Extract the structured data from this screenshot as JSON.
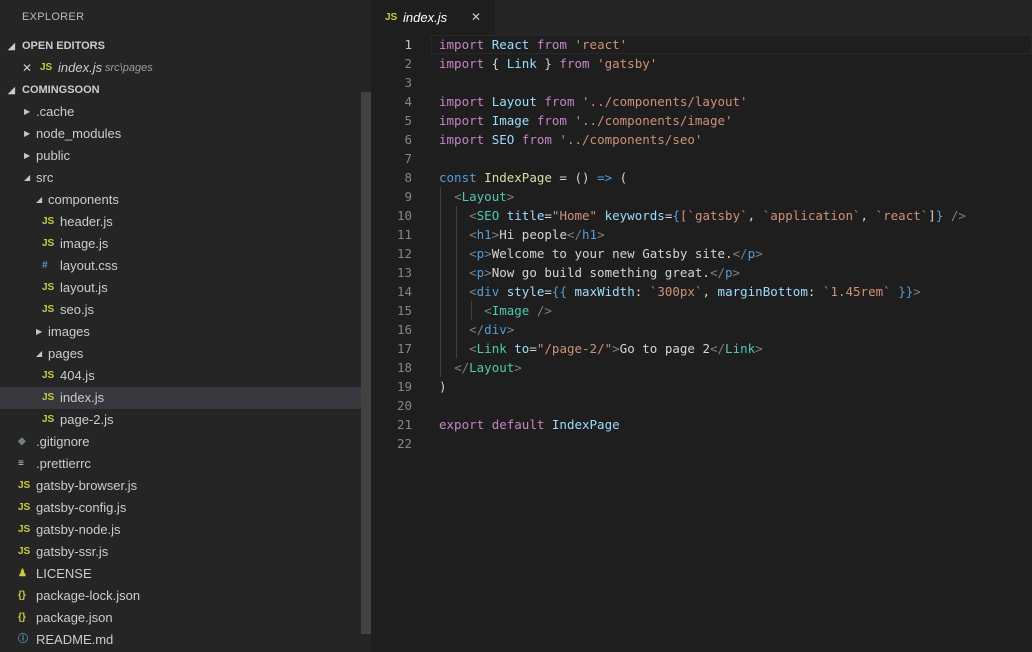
{
  "explorer": {
    "title": "EXPLORER",
    "open_editors_label": "OPEN EDITORS",
    "open_editor": {
      "icon": "JS",
      "name": "index.js",
      "path": "src\\pages"
    },
    "project_label": "COMINGSOON",
    "tree": [
      {
        "name": ".cache",
        "type": "folder",
        "depth": 0,
        "expanded": false,
        "icon": ""
      },
      {
        "name": "node_modules",
        "type": "folder",
        "depth": 0,
        "expanded": false,
        "icon": ""
      },
      {
        "name": "public",
        "type": "folder",
        "depth": 0,
        "expanded": false,
        "icon": ""
      },
      {
        "name": "src",
        "type": "folder",
        "depth": 0,
        "expanded": true,
        "icon": ""
      },
      {
        "name": "components",
        "type": "folder",
        "depth": 1,
        "expanded": true,
        "icon": ""
      },
      {
        "name": "header.js",
        "type": "file",
        "depth": 2,
        "icon": "JS",
        "icon_color": "#cbcb41"
      },
      {
        "name": "image.js",
        "type": "file",
        "depth": 2,
        "icon": "JS",
        "icon_color": "#cbcb41"
      },
      {
        "name": "layout.css",
        "type": "file",
        "depth": 2,
        "icon": "#",
        "icon_color": "#519aba"
      },
      {
        "name": "layout.js",
        "type": "file",
        "depth": 2,
        "icon": "JS",
        "icon_color": "#cbcb41"
      },
      {
        "name": "seo.js",
        "type": "file",
        "depth": 2,
        "icon": "JS",
        "icon_color": "#cbcb41"
      },
      {
        "name": "images",
        "type": "folder",
        "depth": 1,
        "expanded": false,
        "icon": ""
      },
      {
        "name": "pages",
        "type": "folder",
        "depth": 1,
        "expanded": true,
        "icon": ""
      },
      {
        "name": "404.js",
        "type": "file",
        "depth": 2,
        "icon": "JS",
        "icon_color": "#cbcb41"
      },
      {
        "name": "index.js",
        "type": "file",
        "depth": 2,
        "icon": "JS",
        "icon_color": "#cbcb41",
        "selected": true
      },
      {
        "name": "page-2.js",
        "type": "file",
        "depth": 2,
        "icon": "JS",
        "icon_color": "#cbcb41"
      },
      {
        "name": ".gitignore",
        "type": "file",
        "depth": 0,
        "icon": "◆",
        "icon_color": "#6d8086"
      },
      {
        "name": ".prettierrc",
        "type": "file",
        "depth": 0,
        "icon": "≡",
        "icon_color": "#cccccc"
      },
      {
        "name": "gatsby-browser.js",
        "type": "file",
        "depth": 0,
        "icon": "JS",
        "icon_color": "#cbcb41"
      },
      {
        "name": "gatsby-config.js",
        "type": "file",
        "depth": 0,
        "icon": "JS",
        "icon_color": "#cbcb41"
      },
      {
        "name": "gatsby-node.js",
        "type": "file",
        "depth": 0,
        "icon": "JS",
        "icon_color": "#cbcb41"
      },
      {
        "name": "gatsby-ssr.js",
        "type": "file",
        "depth": 0,
        "icon": "JS",
        "icon_color": "#cbcb41"
      },
      {
        "name": "LICENSE",
        "type": "file",
        "depth": 0,
        "icon": "♟",
        "icon_color": "#cbcb41"
      },
      {
        "name": "package-lock.json",
        "type": "file",
        "depth": 0,
        "icon": "{}",
        "icon_color": "#cbcb41"
      },
      {
        "name": "package.json",
        "type": "file",
        "depth": 0,
        "icon": "{}",
        "icon_color": "#cbcb41"
      },
      {
        "name": "README.md",
        "type": "file",
        "depth": 0,
        "icon": "ⓘ",
        "icon_color": "#519aba"
      }
    ]
  },
  "editor": {
    "tab": {
      "icon": "JS",
      "name": "index.js",
      "close": "✕"
    },
    "current_line": 1,
    "lines": [
      [
        [
          "import",
          "cf"
        ],
        [
          " "
        ],
        [
          "React",
          "var"
        ],
        [
          " "
        ],
        [
          "from",
          "cf"
        ],
        [
          " "
        ],
        [
          "'react'",
          "str"
        ]
      ],
      [
        [
          "import",
          "cf"
        ],
        [
          " { "
        ],
        [
          "Link",
          "var"
        ],
        [
          " } "
        ],
        [
          "from",
          "cf"
        ],
        [
          " "
        ],
        [
          "'gatsby'",
          "str"
        ]
      ],
      [],
      [
        [
          "import",
          "cf"
        ],
        [
          " "
        ],
        [
          "Layout",
          "var"
        ],
        [
          " "
        ],
        [
          "from",
          "cf"
        ],
        [
          " "
        ],
        [
          "'../components/layout'",
          "str"
        ]
      ],
      [
        [
          "import",
          "cf"
        ],
        [
          " "
        ],
        [
          "Image",
          "var"
        ],
        [
          " "
        ],
        [
          "from",
          "cf"
        ],
        [
          " "
        ],
        [
          "'../components/image'",
          "str"
        ]
      ],
      [
        [
          "import",
          "cf"
        ],
        [
          " "
        ],
        [
          "SEO",
          "var"
        ],
        [
          " "
        ],
        [
          "from",
          "cf"
        ],
        [
          " "
        ],
        [
          "'../components/seo'",
          "str"
        ]
      ],
      [],
      [
        [
          "const",
          "kw"
        ],
        [
          " "
        ],
        [
          "IndexPage",
          "fn"
        ],
        [
          " = () "
        ],
        [
          "=>",
          "kw"
        ],
        [
          " ("
        ]
      ],
      [
        [
          "  "
        ],
        [
          "<",
          "punc"
        ],
        [
          "Layout",
          "comp"
        ],
        [
          ">",
          "punc"
        ]
      ],
      [
        [
          "    "
        ],
        [
          "<",
          "punc"
        ],
        [
          "SEO",
          "comp"
        ],
        [
          " "
        ],
        [
          "title",
          "attr"
        ],
        [
          "="
        ],
        [
          "\"Home\"",
          "str"
        ],
        [
          " "
        ],
        [
          "keywords",
          "attr"
        ],
        [
          "="
        ],
        [
          "{",
          "kw"
        ],
        [
          "[`gatsby`",
          "str"
        ],
        [
          ", "
        ],
        [
          "`application`",
          "str"
        ],
        [
          ", "
        ],
        [
          "`react`",
          "str"
        ],
        [
          "]"
        ],
        [
          "}",
          "kw"
        ],
        [
          " "
        ],
        [
          "/>",
          "punc"
        ]
      ],
      [
        [
          "    "
        ],
        [
          "<",
          "punc"
        ],
        [
          "h1",
          "tag"
        ],
        [
          ">",
          "punc"
        ],
        [
          "Hi people",
          "txt"
        ],
        [
          "</",
          "punc"
        ],
        [
          "h1",
          "tag"
        ],
        [
          ">",
          "punc"
        ]
      ],
      [
        [
          "    "
        ],
        [
          "<",
          "punc"
        ],
        [
          "p",
          "tag"
        ],
        [
          ">",
          "punc"
        ],
        [
          "Welcome to your new Gatsby site.",
          "txt"
        ],
        [
          "</",
          "punc"
        ],
        [
          "p",
          "tag"
        ],
        [
          ">",
          "punc"
        ]
      ],
      [
        [
          "    "
        ],
        [
          "<",
          "punc"
        ],
        [
          "p",
          "tag"
        ],
        [
          ">",
          "punc"
        ],
        [
          "Now go build something great.",
          "txt"
        ],
        [
          "</",
          "punc"
        ],
        [
          "p",
          "tag"
        ],
        [
          ">",
          "punc"
        ]
      ],
      [
        [
          "    "
        ],
        [
          "<",
          "punc"
        ],
        [
          "div",
          "tag"
        ],
        [
          " "
        ],
        [
          "style",
          "attr"
        ],
        [
          "="
        ],
        [
          "{{",
          "kw"
        ],
        [
          " "
        ],
        [
          "maxWidth",
          "var"
        ],
        [
          ": "
        ],
        [
          "`300px`",
          "str"
        ],
        [
          ", "
        ],
        [
          "marginBottom",
          "var"
        ],
        [
          ": "
        ],
        [
          "`1.45rem`",
          "str"
        ],
        [
          " "
        ],
        [
          "}}",
          "kw"
        ],
        [
          ">",
          "punc"
        ]
      ],
      [
        [
          "      "
        ],
        [
          "<",
          "punc"
        ],
        [
          "Image",
          "comp"
        ],
        [
          " "
        ],
        [
          "/>",
          "punc"
        ]
      ],
      [
        [
          "    "
        ],
        [
          "</",
          "punc"
        ],
        [
          "div",
          "tag"
        ],
        [
          ">",
          "punc"
        ]
      ],
      [
        [
          "    "
        ],
        [
          "<",
          "punc"
        ],
        [
          "Link",
          "comp"
        ],
        [
          " "
        ],
        [
          "to",
          "attr"
        ],
        [
          "="
        ],
        [
          "\"/page-2/\"",
          "str"
        ],
        [
          ">",
          "punc"
        ],
        [
          "Go to page 2",
          "txt"
        ],
        [
          "</",
          "punc"
        ],
        [
          "Link",
          "comp"
        ],
        [
          ">",
          "punc"
        ]
      ],
      [
        [
          "  "
        ],
        [
          "</",
          "punc"
        ],
        [
          "Layout",
          "comp"
        ],
        [
          ">",
          "punc"
        ]
      ],
      [
        [
          ")"
        ]
      ],
      [],
      [
        [
          "export",
          "cf"
        ],
        [
          " "
        ],
        [
          "default",
          "cf"
        ],
        [
          " "
        ],
        [
          "IndexPage",
          "var"
        ]
      ],
      []
    ]
  }
}
